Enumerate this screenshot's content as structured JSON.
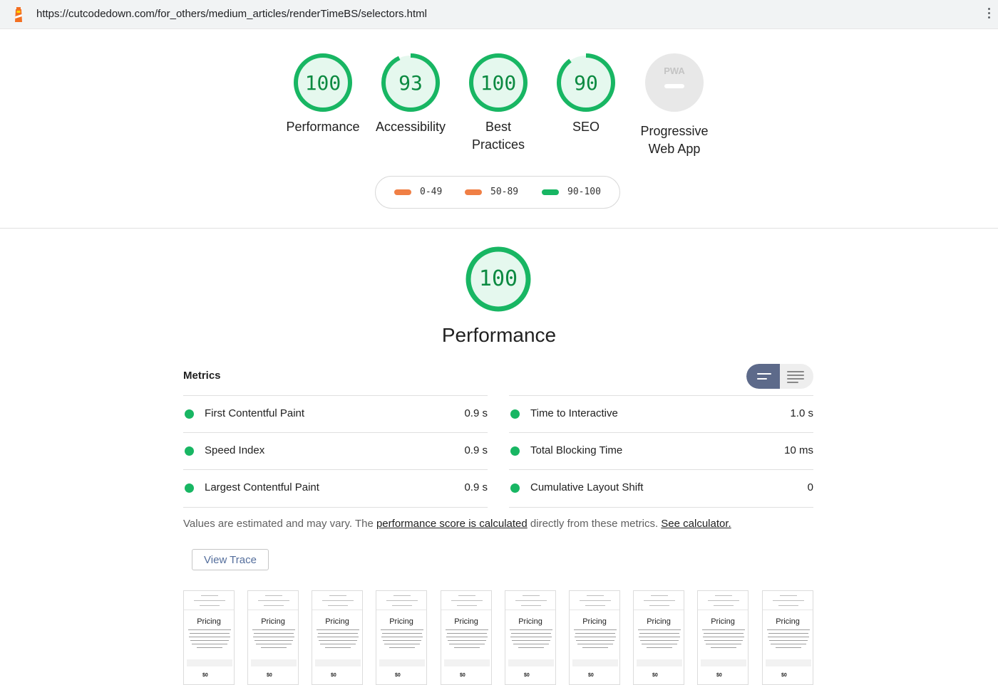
{
  "browser": {
    "url": "https://cutcodedown.com/for_others/medium_articles/renderTimeBS/selectors.html"
  },
  "colors": {
    "pass": "#18b663",
    "average": "#ffa400",
    "fail": "#ff4e42",
    "pass_text": "#0c8a41"
  },
  "gauges": [
    {
      "score": "100",
      "value": 100,
      "label1": "Performance",
      "label2": ""
    },
    {
      "score": "93",
      "value": 93,
      "label1": "Accessibility",
      "label2": ""
    },
    {
      "score": "100",
      "value": 100,
      "label1": "Best",
      "label2": "Practices"
    },
    {
      "score": "90",
      "value": 90,
      "label1": "SEO",
      "label2": ""
    },
    {
      "score": "PWA",
      "label1": "Progressive",
      "label2": "Web App"
    }
  ],
  "legend": [
    {
      "range": "0-49"
    },
    {
      "range": "50-89"
    },
    {
      "range": "90-100"
    }
  ],
  "category": {
    "score": "100",
    "value": 100,
    "title": "Performance"
  },
  "metrics": {
    "heading": "Metrics",
    "left": [
      {
        "name": "First Contentful Paint",
        "value": "0.9 s"
      },
      {
        "name": "Speed Index",
        "value": "0.9 s"
      },
      {
        "name": "Largest Contentful Paint",
        "value": "0.9 s"
      }
    ],
    "right": [
      {
        "name": "Time to Interactive",
        "value": "1.0 s"
      },
      {
        "name": "Total Blocking Time",
        "value": "10 ms"
      },
      {
        "name": "Cumulative Layout Shift",
        "value": "0"
      }
    ]
  },
  "note": {
    "before": "Values are estimated and may vary. The ",
    "link1": "performance score is calculated",
    "middle": " directly from these metrics. ",
    "link2": "See calculator."
  },
  "view_trace_label": "View Trace",
  "filmstrip": {
    "frame_title": "Pricing",
    "frame_price": "$0"
  }
}
